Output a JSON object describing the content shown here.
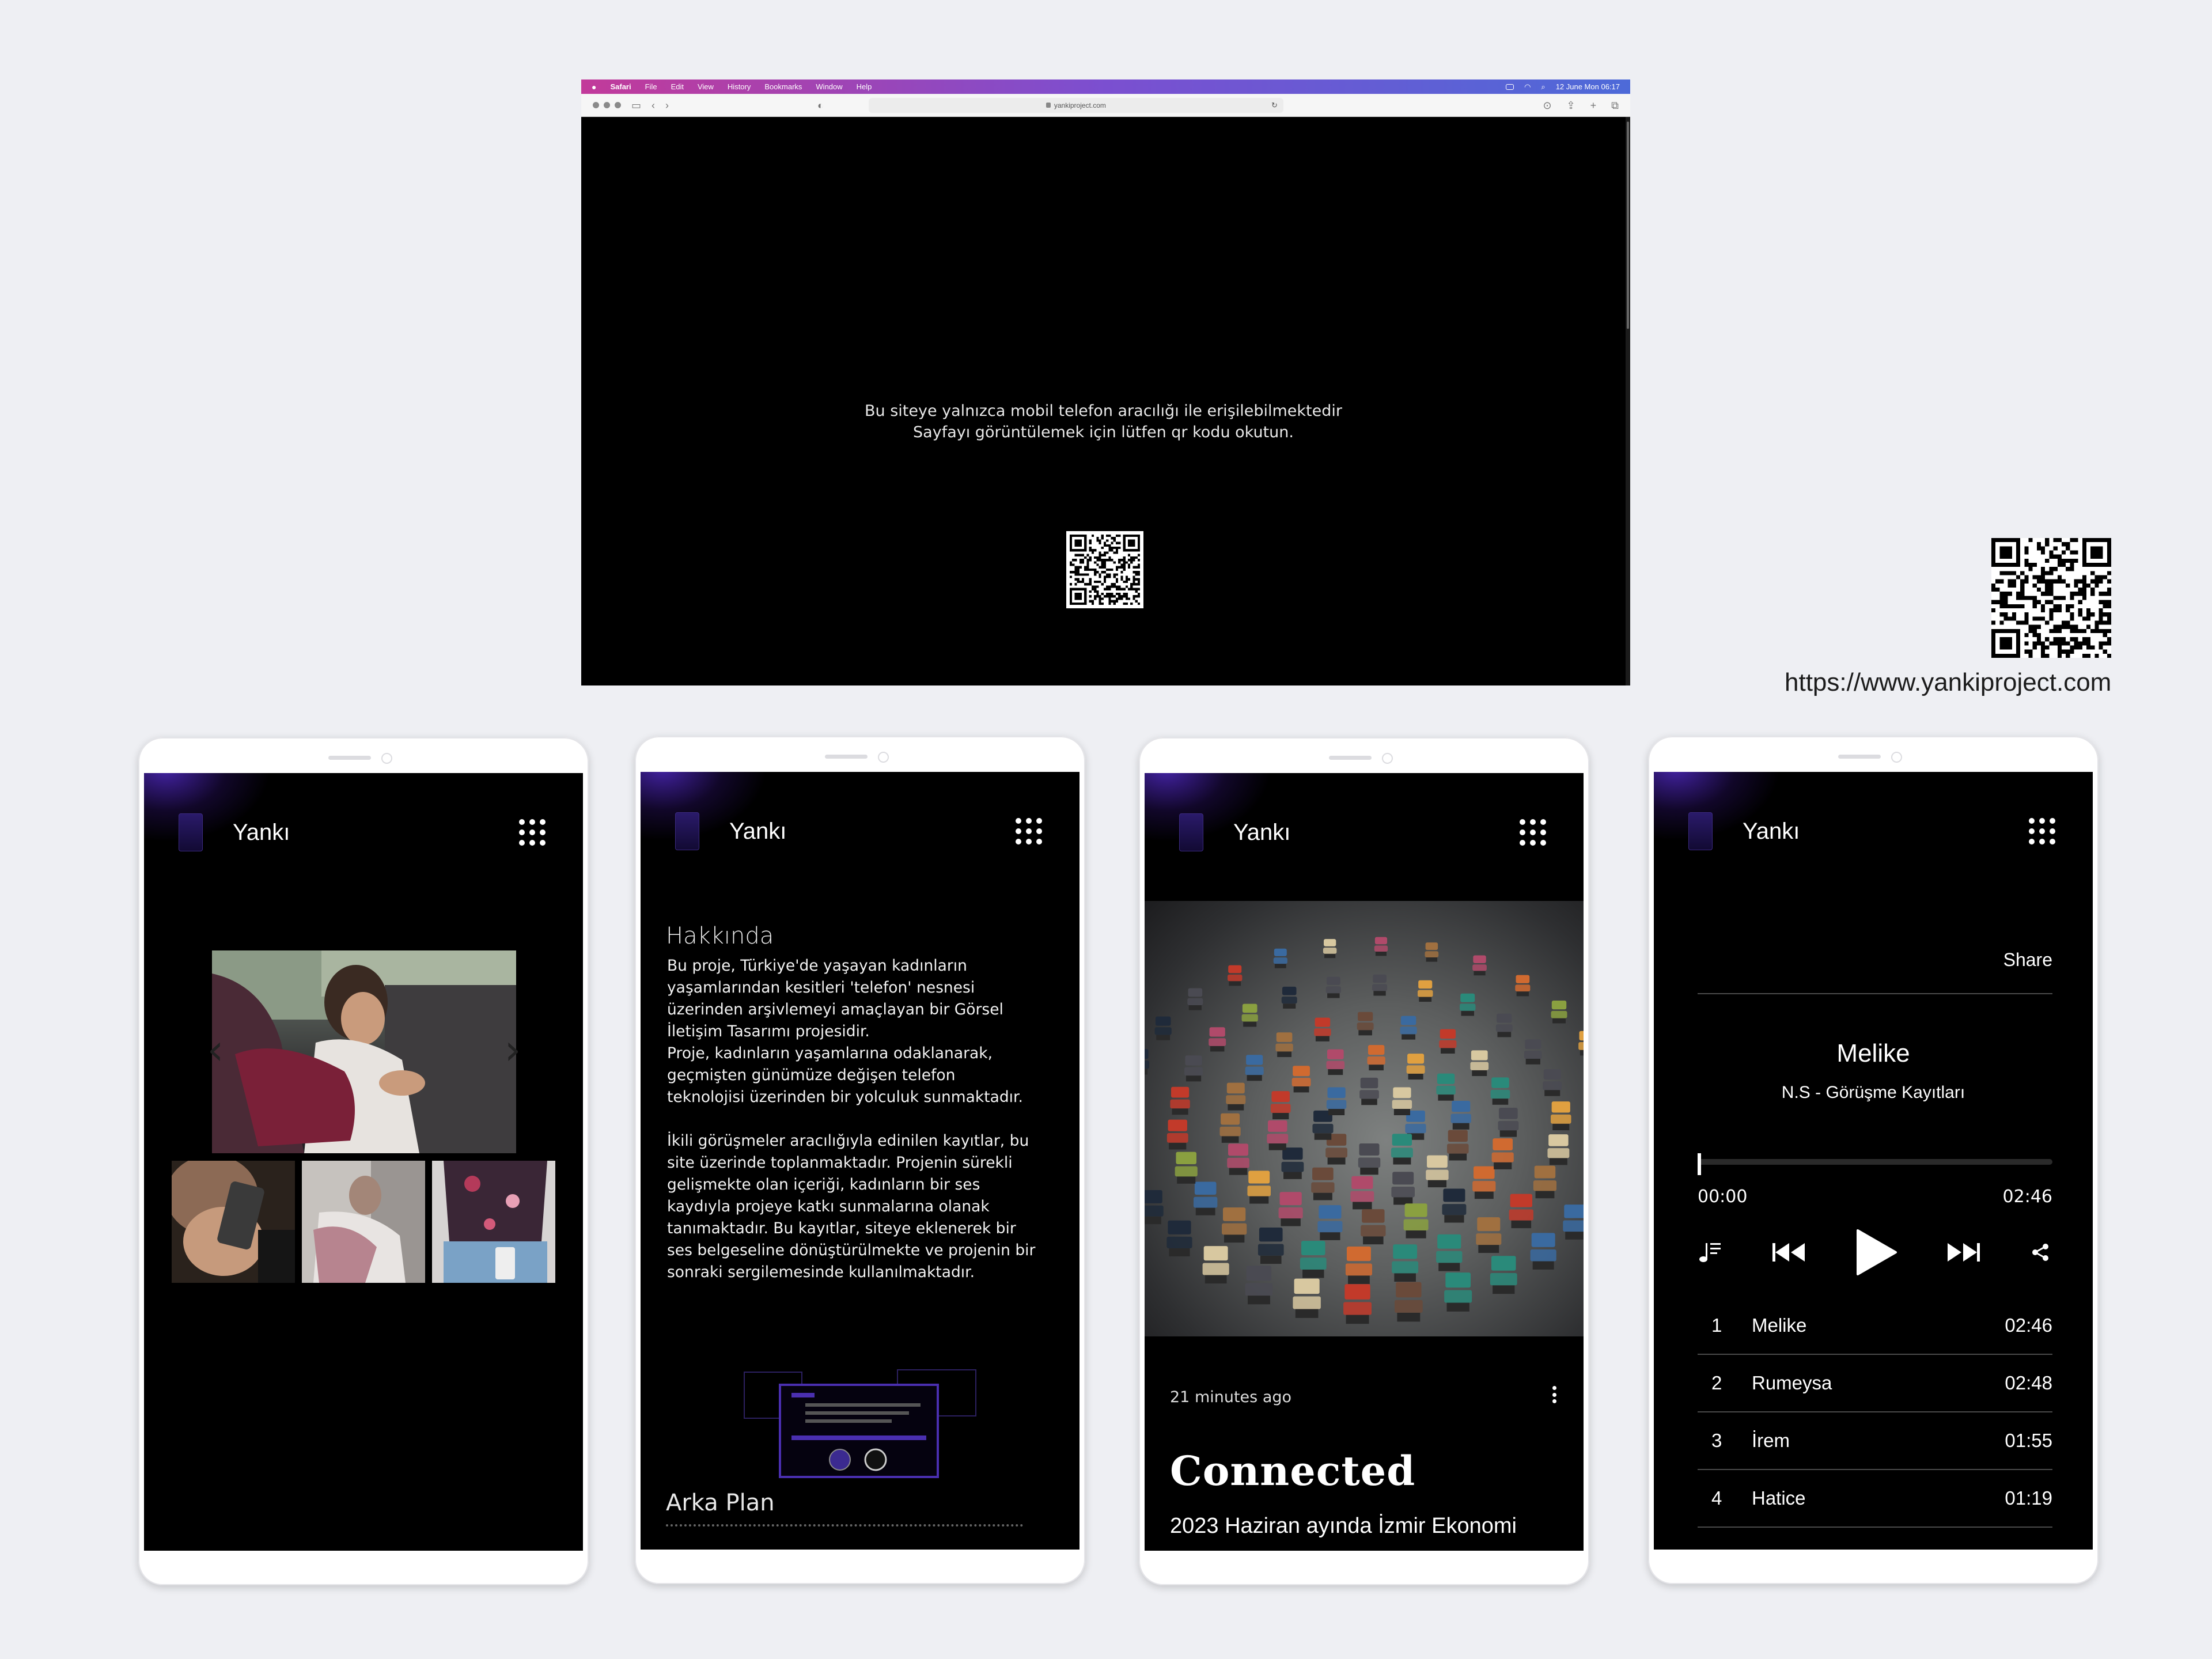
{
  "browser": {
    "menu": {
      "apple": "",
      "app": "Safari",
      "items": [
        "File",
        "Edit",
        "View",
        "History",
        "Bookmarks",
        "Window",
        "Help"
      ],
      "clock": "12 June Mon 06:17"
    },
    "url": "yankiproject.com",
    "message_line1": "Bu siteye yalnızca mobil telefon aracılığı ile erişilebilmektedir",
    "message_line2": "Sayfayı görüntülemek için lütfen qr kodu okutun."
  },
  "side_url": "https://www.yankiproject.com",
  "app_name": "Yankı",
  "phone2": {
    "about_title": "Hakkında",
    "about_body": "Bu proje, Türkiye'de yaşayan kadınların\nyaşamlarından kesitleri 'telefon' nesnesi\nüzerinden arşivlemeyi amaçlayan bir Görsel\nİletişim Tasarımı projesidir.\nProje, kadınların yaşamlarına odaklanarak,\ngeçmişten günümüze değişen telefon\nteknolojisi üzerinden bir yolculuk sunmaktadır.\n\nİkili görüşmeler aracılığıyla edinilen kayıtlar, bu\nsite üzerinde toplanmaktadır. Projenin sürekli\ngelişmekte olan içeriği, kadınların bir ses\nkaydıyla projeye katkı sunmalarına olanak\ntanımaktadır. Bu kayıtlar, siteye eklenerek bir\nses belgeseline dönüştürülmekte ve projenin bir\nsonraki sergilemesinde kullanılmaktadır.",
    "background_title": "Arka Plan"
  },
  "phone3": {
    "time_ago": "21 minutes ago",
    "post_title": "Connected",
    "post_subtitle": "2023 Haziran ayında İzmir Ekonomi"
  },
  "phone4": {
    "share": "Share",
    "track_name": "Melike",
    "album_name": "N.S - Görüşme Kayıtları",
    "time_current": "00:00",
    "time_total": "02:46",
    "progress": 0,
    "tracks": [
      {
        "num": "1",
        "title": "Melike",
        "duration": "02:46"
      },
      {
        "num": "2",
        "title": "Rumeysa",
        "duration": "02:48"
      },
      {
        "num": "3",
        "title": "İrem",
        "duration": "01:55"
      },
      {
        "num": "4",
        "title": "Hatice",
        "duration": "01:19"
      }
    ]
  },
  "icons": [
    "apple-icon",
    "sidebar-icon",
    "back-icon",
    "forward-icon",
    "shield-icon",
    "lock-icon",
    "reload-icon",
    "download-icon",
    "share-icon",
    "new-tab-icon",
    "tabs-icon",
    "grid-menu-icon",
    "playlist-icon",
    "previous-icon",
    "play-icon",
    "next-icon",
    "share-nodes-icon",
    "more-icon",
    "qr-code-icon"
  ],
  "colors": {
    "menubar_start": "#c23a9a",
    "menubar_end": "#4d6ad8",
    "accent_purple": "#3b2a80",
    "background": "#eeeff3"
  }
}
